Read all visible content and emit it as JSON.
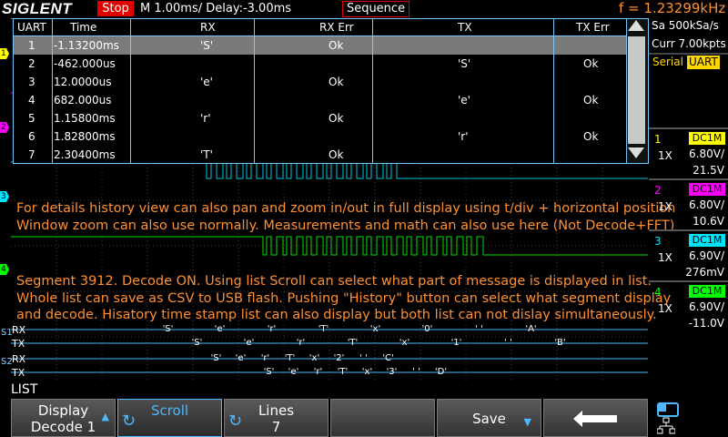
{
  "header": {
    "logo": "SIGLENT",
    "run_state": "Stop",
    "timebase": "M 1.00ms/ Delay:-3.00ms",
    "mode": "Sequence",
    "frequency": "f = 1.23299kHz"
  },
  "side": {
    "sample_rate": "Sa 500kSa/s",
    "curr_points": "Curr 7.00kpts",
    "trigger_type": "Serial",
    "trigger_protocol": "UART",
    "channels": [
      {
        "num": "1",
        "coupling": "DC1M",
        "probe": "1X",
        "vdiv": "6.80V/",
        "offset": "21.5V",
        "color": "#ffff00"
      },
      {
        "num": "2",
        "coupling": "DC1M",
        "probe": "1X",
        "vdiv": "6.80V/",
        "offset": "10.6V",
        "color": "#ff00ff"
      },
      {
        "num": "3",
        "coupling": "DC1M",
        "probe": "1X",
        "vdiv": "6.90V/",
        "offset": "276mV",
        "color": "#00e5ff"
      },
      {
        "num": "4",
        "coupling": "DC1M",
        "probe": "1X",
        "vdiv": "6.90V/",
        "offset": "-11.0V",
        "color": "#00ff00"
      }
    ]
  },
  "table": {
    "headers": [
      "UART",
      "Time",
      "RX",
      "RX Err",
      "TX",
      "TX Err"
    ],
    "rows": [
      [
        "1",
        "-1.13200ms",
        "'S'",
        "Ok",
        "",
        ""
      ],
      [
        "2",
        "-462.000us",
        "",
        "",
        "'S'",
        "Ok"
      ],
      [
        "3",
        "12.0000us",
        "'e'",
        "Ok",
        "",
        ""
      ],
      [
        "4",
        "682.000us",
        "",
        "",
        "'e'",
        "Ok"
      ],
      [
        "5",
        "1.15800ms",
        "'r'",
        "Ok",
        "",
        ""
      ],
      [
        "6",
        "1.82800ms",
        "",
        "",
        "'r'",
        "Ok"
      ],
      [
        "7",
        "2.30400ms",
        "'T'",
        "Ok",
        "",
        ""
      ]
    ],
    "selected_row": 0
  },
  "notes": {
    "line1": "For details history view can also pan and zoom in/out in full display using  t/div + horizontal position",
    "line2": "Window zoom can also use normally. Measurements and math can also use here (Not Decode+FFT)",
    "line3": "Segment 3912.  Decode ON. Using list Scroll can select what part of message is displayed in list.",
    "line4": "Whole list can save as CSV to USB flash. Pushing \"History\" button can select what segment display",
    "line5": "and decode. Hisatory time stamp list can also display but both list can not dislay simultaneously."
  },
  "bus1": {
    "label": "S1",
    "rx_label": "RX",
    "tx_label": "TX",
    "rx": [
      "'S'",
      "'e'",
      "'r'",
      "'T'",
      "'x'",
      "'0'",
      "' '",
      "'A'"
    ],
    "tx": [
      "'S'",
      "'e'",
      "'r'",
      "'T'",
      "'x'",
      "'1'",
      "' '",
      "'B'"
    ]
  },
  "bus2": {
    "label": "S2",
    "rx_label": "RX",
    "tx_label": "TX",
    "rx": [
      "'S'",
      "'e'",
      "'r'",
      "'T'",
      "'x'",
      "'2'",
      "' '",
      "'C'"
    ],
    "tx": [
      "'S'",
      "'e'",
      "'r'",
      "'T'",
      "'x'",
      "'3'",
      "' '",
      "'D'"
    ]
  },
  "menu": {
    "title": "LIST",
    "display_l1": "Display",
    "display_l2": "Decode 1",
    "scroll": "Scroll",
    "lines_l1": "Lines",
    "lines_l2": "7",
    "save": "Save"
  }
}
